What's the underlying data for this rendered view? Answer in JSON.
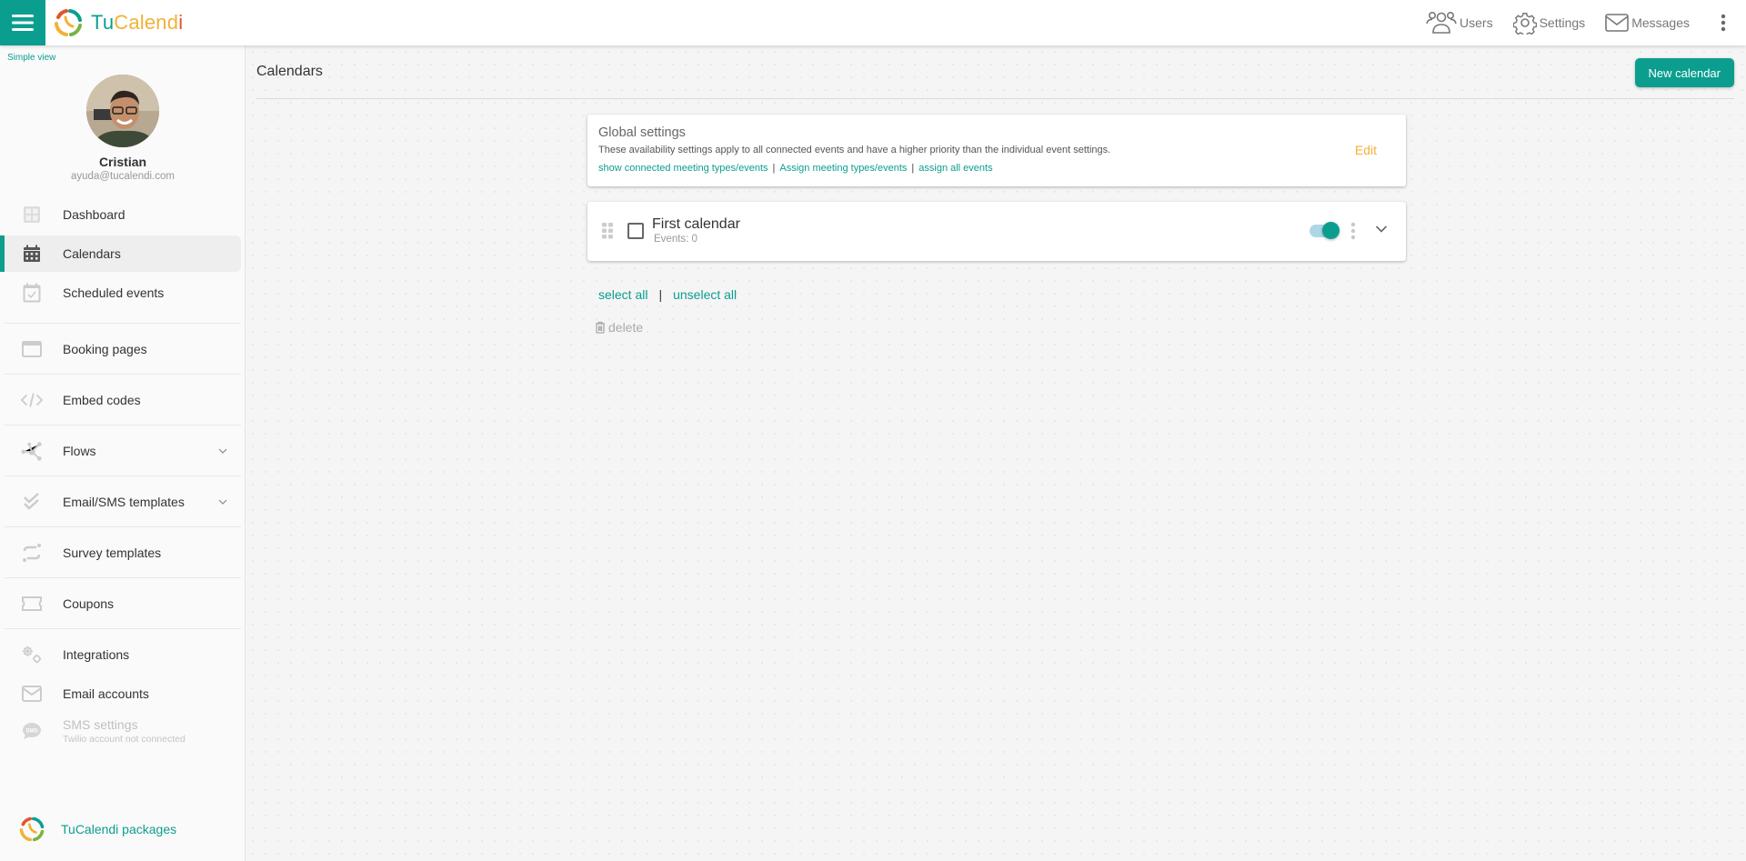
{
  "app": {
    "brand_parts": [
      "Tu",
      "Calend",
      "i"
    ],
    "brand_colors": {
      "teal": "#0b9e8f",
      "yellow": "#f2b236",
      "red": "#e4542a"
    }
  },
  "topbar": {
    "links": [
      {
        "label": "Users",
        "icon": "users-icon"
      },
      {
        "label": "Settings",
        "icon": "gear-icon"
      },
      {
        "label": "Messages",
        "icon": "envelope-icon"
      }
    ]
  },
  "sidebar": {
    "simple_view": "Simple view",
    "user": {
      "name": "Cristian",
      "email": "ayuda@tucalendi.com"
    },
    "items": [
      {
        "label": "Dashboard",
        "icon": "dashboard-icon"
      },
      {
        "label": "Calendars",
        "icon": "calendar-icon",
        "active": true
      },
      {
        "label": "Scheduled events",
        "icon": "calendar-check-icon"
      },
      {
        "label": "Booking pages",
        "icon": "browser-window-icon"
      },
      {
        "label": "Embed codes",
        "icon": "code-icon"
      },
      {
        "label": "Flows",
        "icon": "flows-icon",
        "expandable": true
      },
      {
        "label": "Email/SMS templates",
        "icon": "double-check-icon",
        "expandable": true
      },
      {
        "label": "Survey templates",
        "icon": "survey-icon"
      },
      {
        "label": "Coupons",
        "icon": "ticket-icon"
      },
      {
        "label": "Integrations",
        "icon": "gears-icon"
      },
      {
        "label": "Email accounts",
        "icon": "envelope-icon"
      },
      {
        "label": "SMS settings",
        "sublabel": "Twilio account not connected",
        "icon": "sms-bubble-icon",
        "disabled": true
      }
    ],
    "packages_label": "TuCalendi packages"
  },
  "main": {
    "title": "Calendars",
    "new_button": "New calendar",
    "global_settings": {
      "title": "Global settings",
      "description": "These availability settings apply to all connected events and have a higher priority than the individual event settings.",
      "links": [
        "show connected meeting types/events",
        "Assign meeting types/events",
        "assign all events"
      ],
      "edit_label": "Edit"
    },
    "calendars": [
      {
        "name": "First calendar",
        "events_text": "Events: 0",
        "enabled": true,
        "selected": false
      }
    ],
    "select_all": "select all",
    "unselect_all": "unselect all",
    "separator": "|",
    "delete_label": "delete"
  }
}
